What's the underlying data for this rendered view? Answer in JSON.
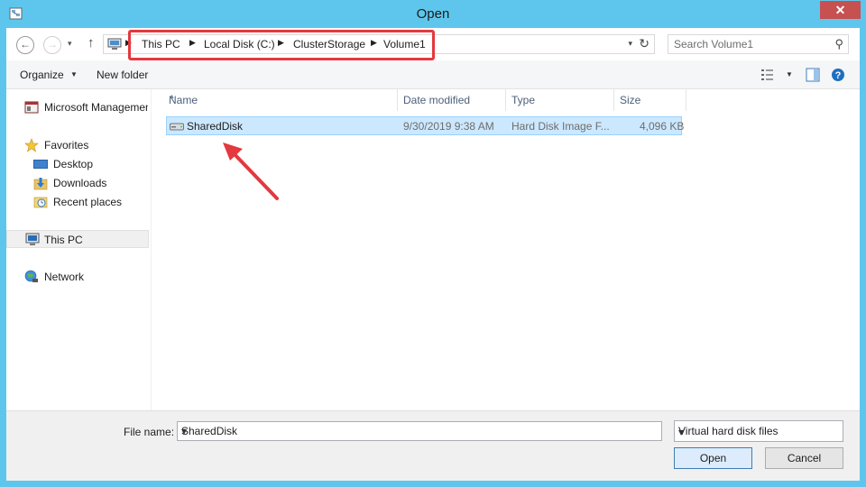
{
  "window": {
    "title": "Open",
    "close_glyph": "✕"
  },
  "nav": {
    "back_glyph": "←",
    "forward_glyph": "→",
    "recent_glyph": "▾",
    "up_glyph": "↑"
  },
  "address": {
    "crumbs": [
      "This PC",
      "Local Disk (C:)",
      "ClusterStorage",
      "Volume1"
    ],
    "separator": "▶",
    "dropdown_glyph": "▾",
    "refresh_glyph": "↻"
  },
  "search": {
    "placeholder": "Search Volume1",
    "icon_glyph": "⚲"
  },
  "toolbar": {
    "organize_label": "Organize",
    "organize_caret": "▼",
    "new_folder_label": "New folder",
    "view_caret": "▼",
    "help_glyph": "?"
  },
  "sidebar": {
    "items": [
      {
        "label": "Microsoft Management Console",
        "icon": "mmc-icon"
      },
      {
        "label": "Favorites",
        "icon": "star-icon"
      },
      {
        "label": "Desktop",
        "icon": "desktop-icon"
      },
      {
        "label": "Downloads",
        "icon": "downloads-icon"
      },
      {
        "label": "Recent places",
        "icon": "recent-places-icon"
      },
      {
        "label": "This PC",
        "icon": "computer-icon"
      },
      {
        "label": "Network",
        "icon": "network-icon"
      }
    ]
  },
  "file_list": {
    "columns": [
      "Name",
      "Date modified",
      "Type",
      "Size"
    ],
    "sort_glyph": "▲",
    "rows": [
      {
        "name": "SharedDisk",
        "date_modified": "9/30/2019 9:38 AM",
        "type": "Hard Disk Image F...",
        "size": "4,096 KB",
        "icon": "hard-disk-image-icon"
      }
    ]
  },
  "bottom": {
    "file_name_label": "File name:",
    "file_name_value": "SharedDisk",
    "file_name_drop": "▾",
    "file_type_value": "Virtual hard disk files",
    "file_type_drop": "▾",
    "open_label": "Open",
    "cancel_label": "Cancel"
  },
  "colors": {
    "window_frame": "#5ec6ec",
    "selection_fill": "#cce8ff",
    "selection_border": "#99d1ff",
    "annotation_red": "#e3393f",
    "close_button": "#c75050"
  }
}
